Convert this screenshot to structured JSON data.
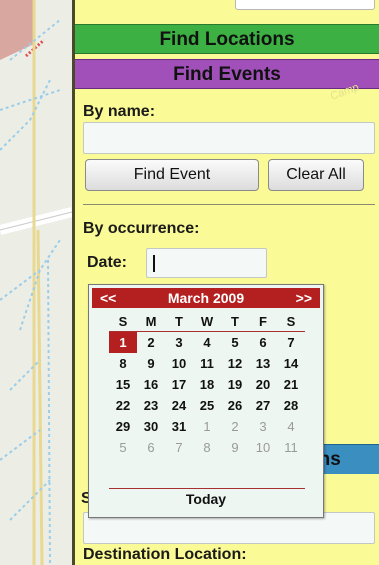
{
  "panel": {
    "sections": {
      "find_locations": "Find Locations",
      "find_events": "Find Events",
      "routes_fragment": "ons"
    },
    "watermark": "Camp"
  },
  "find_events": {
    "by_name_label": "By name:",
    "name_value": "",
    "find_button": "Find Event",
    "clear_button": "Clear All",
    "by_occurrence_label": "By occurrence:",
    "date_label": "Date:",
    "date_value": ""
  },
  "calendar": {
    "prev": "<<",
    "next": ">>",
    "month_title": "March 2009",
    "weekdays": [
      "S",
      "M",
      "T",
      "W",
      "T",
      "F",
      "S"
    ],
    "weeks": [
      [
        {
          "d": "1",
          "t": 1
        },
        {
          "d": "2"
        },
        {
          "d": "3"
        },
        {
          "d": "4"
        },
        {
          "d": "5"
        },
        {
          "d": "6"
        },
        {
          "d": "7"
        }
      ],
      [
        {
          "d": "8"
        },
        {
          "d": "9"
        },
        {
          "d": "10"
        },
        {
          "d": "11"
        },
        {
          "d": "12"
        },
        {
          "d": "13"
        },
        {
          "d": "14"
        }
      ],
      [
        {
          "d": "15"
        },
        {
          "d": "16"
        },
        {
          "d": "17"
        },
        {
          "d": "18"
        },
        {
          "d": "19"
        },
        {
          "d": "20"
        },
        {
          "d": "21"
        }
      ],
      [
        {
          "d": "22"
        },
        {
          "d": "23"
        },
        {
          "d": "24"
        },
        {
          "d": "25"
        },
        {
          "d": "26"
        },
        {
          "d": "27"
        },
        {
          "d": "28"
        }
      ],
      [
        {
          "d": "29"
        },
        {
          "d": "30"
        },
        {
          "d": "31"
        },
        {
          "d": "1",
          "o": 1
        },
        {
          "d": "2",
          "o": 1
        },
        {
          "d": "3",
          "o": 1
        },
        {
          "d": "4",
          "o": 1
        }
      ],
      [
        {
          "d": "5",
          "o": 1
        },
        {
          "d": "6",
          "o": 1
        },
        {
          "d": "7",
          "o": 1
        },
        {
          "d": "8",
          "o": 1
        },
        {
          "d": "9",
          "o": 1
        },
        {
          "d": "10",
          "o": 1
        },
        {
          "d": "11",
          "o": 1
        }
      ]
    ],
    "today_label": "Today"
  },
  "route": {
    "start_label_fragment": "S",
    "start_value": "",
    "destination_label": "Destination Location:"
  },
  "colors": {
    "panel_bg": "#fafa96",
    "find_locations_bar": "#3cb043",
    "find_events_bar": "#a050b8",
    "routes_bar": "#3b8ec0",
    "calendar_accent": "#b42020"
  }
}
